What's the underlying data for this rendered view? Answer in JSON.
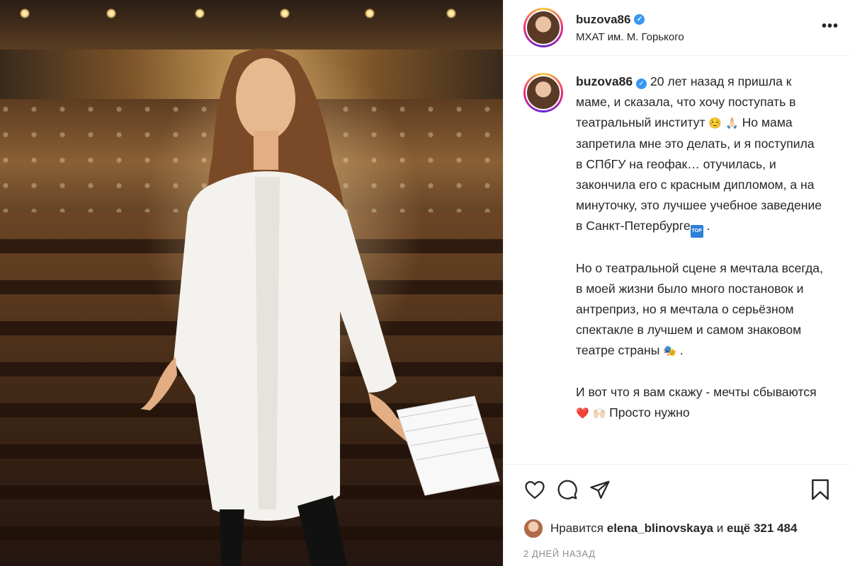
{
  "post": {
    "username": "buzova86",
    "location": "МХАТ им. М. Горького",
    "more_label": "•••"
  },
  "caption": {
    "username": "buzova86",
    "p1_a": "20 лет назад я пришла к маме, и сказала, что хочу поступать в театральный институт",
    "p1_emoji1": "☺️",
    "p1_emoji2": "🙏🏻",
    "p1_b": "Но мама запретила мне это делать, и я поступила в СПбГУ на геофак… отучилась, и закончила его с красным дипломом, а на минуточку, это лучшее учебное заведение в Санкт-Петербурге",
    "p1_badge": "TOP",
    "p1_end": ".",
    "p2": "Но о театральной сцене я мечтала всегда, в моей жизни было много постановок и антреприз, но я мечтала о серьёзном спектакле в лучшем и самом знаковом театре страны",
    "p2_emoji": "🎭",
    "p2_end": ".",
    "p3_a": "И вот что я вам скажу - мечты сбываются",
    "p3_emoji1": "❤️",
    "p3_emoji2": "🙌🏻",
    "p3_b": "Просто нужно"
  },
  "likes": {
    "prefix": "Нравится",
    "user": "elena_blinovskaya",
    "middle": "и",
    "rest": "ещё 321 484"
  },
  "date": "2 ДНЕЙ НАЗАД",
  "icons": {
    "like": "heart-icon",
    "comment": "comment-icon",
    "share": "share-icon",
    "save": "bookmark-icon",
    "verified": "verified-icon"
  },
  "colors": {
    "verified": "#3897f0",
    "muted": "#8e8e8e",
    "text": "#262626"
  }
}
